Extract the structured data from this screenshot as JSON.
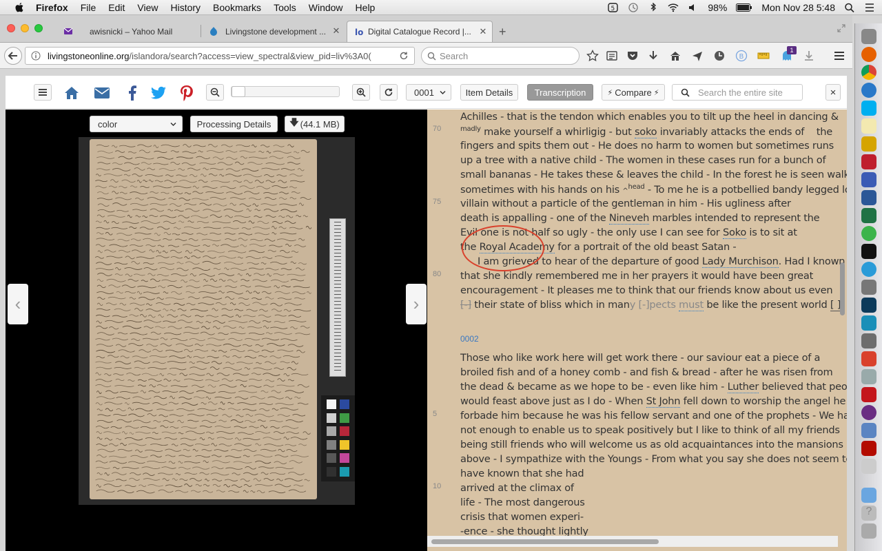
{
  "menubar": {
    "app": "Firefox",
    "items": [
      "File",
      "Edit",
      "View",
      "History",
      "Bookmarks",
      "Tools",
      "Window",
      "Help"
    ],
    "battery": "98%",
    "clock": "Mon Nov 28  5:48"
  },
  "tabs": [
    {
      "label": "awisnicki – Yahoo Mail"
    },
    {
      "label": "Livingstone development ..."
    },
    {
      "label": "Digital Catalogue Record |..."
    }
  ],
  "nav": {
    "url_host": "livingstoneonline.org",
    "url_path": "/islandora/search?access=view_spectral&view_pid=liv%3A0(",
    "search_placeholder": "Search",
    "notification_count": "1"
  },
  "toolbar": {
    "page_select": "0001",
    "item_details": "Item Details",
    "transcription": "Transcription",
    "compare": "Compare",
    "site_search_placeholder": "Search the entire site",
    "close": "×"
  },
  "viewer": {
    "color_select": "color",
    "processing_details": "Processing Details",
    "download_size": "(44.1 MB)"
  },
  "transcript": {
    "page_label": "0002",
    "line_numbers": [
      "70",
      "75",
      "80",
      "5",
      "10"
    ],
    "lines_p1": [
      "Achilles - that is the tendon which enables you to tilt up the heel in dancing &",
      "madly",
      "make yourself a whirligig - but",
      "soko",
      "invariably attacks the ends of",
      "the",
      "fingers and spits them out - He does no harm to women but sometimes runs",
      "up a tree with a native child - The women in these cases run for a bunch of",
      "small bananas - He takes these & leaves the child - In the forest he is seen walking",
      "sometimes with his hands on his",
      "head",
      "- To me he is a potbellied bandy legged low",
      "villain without a particle of the gentleman in him - His ugliness after",
      "death is appalling - one of the",
      "Nineveh",
      "marbles intended to represent the",
      "Evil one is not half so ugly - the only use I can see for",
      "Soko",
      "is to sit at",
      "the",
      "Royal Academy",
      "for a portrait of the old beast Satan -",
      "I am grieved to hear of the departure of good",
      "Lady Murchison",
      ". Had I known",
      "that she kindly remembered me in her prayers it would have been great",
      "encouragement - It pleases me to think that our friends know about us even",
      "[-]",
      "their state of bliss which in man",
      "y",
      "[-]pects",
      "must",
      "be like the present world",
      "[    ]"
    ],
    "lines_p2": [
      "Those who like work here will get work there - our saviour eat a piece of a",
      "broiled fish and of a honey comb - and fish & bread - after he was risen from",
      "the dead & became as we hope to be - even like him -",
      "Luther",
      "believed that people",
      "would feast above just as I do - When",
      "St John",
      "fell down to worship the angel he",
      "forbade him because he was his fellow servant and one of the prophets - We have",
      "not enough to enable us to speak positively but I like to think of all my friends",
      "being still friends who will welcome us as old acquaintances into the mansions",
      "above - I sympathize with the Youngs - From what you say she does not seem to",
      "have known that she had",
      "arrived at the climax of",
      "life - The most dangerous",
      "crisis that women experi-",
      "-ence - she thought lightly"
    ]
  },
  "colors": {
    "transcript_bg": "#d8c3a5",
    "link_blue": "#2a7ac7",
    "twitter": "#1da1f2",
    "facebook": "#3b5998",
    "pinterest": "#cb2027",
    "home": "#3a6ea5",
    "annotation_red": "#d9412c"
  }
}
